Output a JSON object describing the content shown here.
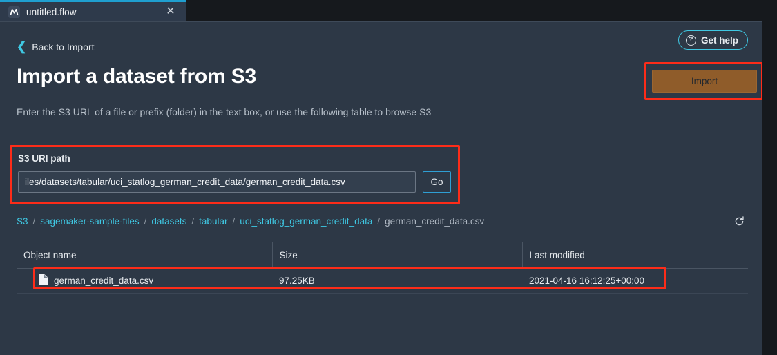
{
  "tab": {
    "title": "untitled.flow",
    "icon": "flow-app-icon",
    "close_label": "✕"
  },
  "header": {
    "back_label": "Back to Import",
    "back_icon": "chevron-left-icon",
    "get_help_label": "Get help",
    "get_help_icon": "question-circle-icon",
    "title": "Import a dataset from S3",
    "subtitle": "Enter the S3 URL of a file or prefix (folder) in the text box, or use the following table to browse S3",
    "import_label": "Import"
  },
  "uri_field": {
    "label": "S3 URI path",
    "value": "iles/datasets/tabular/uci_statlog_german_credit_data/german_credit_data.csv",
    "placeholder": "S3 URI path",
    "go_label": "Go"
  },
  "breadcrumb": {
    "separator": "/",
    "items": [
      {
        "label": "S3",
        "current": false
      },
      {
        "label": "sagemaker-sample-files",
        "current": false
      },
      {
        "label": "datasets",
        "current": false
      },
      {
        "label": "tabular",
        "current": false
      },
      {
        "label": "uci_statlog_german_credit_data",
        "current": false
      },
      {
        "label": "german_credit_data.csv",
        "current": true
      }
    ],
    "refresh_icon": "refresh-icon"
  },
  "table": {
    "columns": [
      "Object name",
      "Size",
      "Last modified"
    ],
    "rows": [
      {
        "icon": "file-icon",
        "name": "german_credit_data.csv",
        "size": "97.25KB",
        "last_modified": "2021-04-16 16:12:25+00:00"
      }
    ]
  },
  "colors": {
    "accent_cyan": "#3fc8e3",
    "tab_active_border": "#1f9fd0",
    "import_button": "#8f5c2a",
    "highlight_red": "#fd2c19",
    "panel_bg": "#2d3846",
    "chrome_bg": "#16191d"
  }
}
